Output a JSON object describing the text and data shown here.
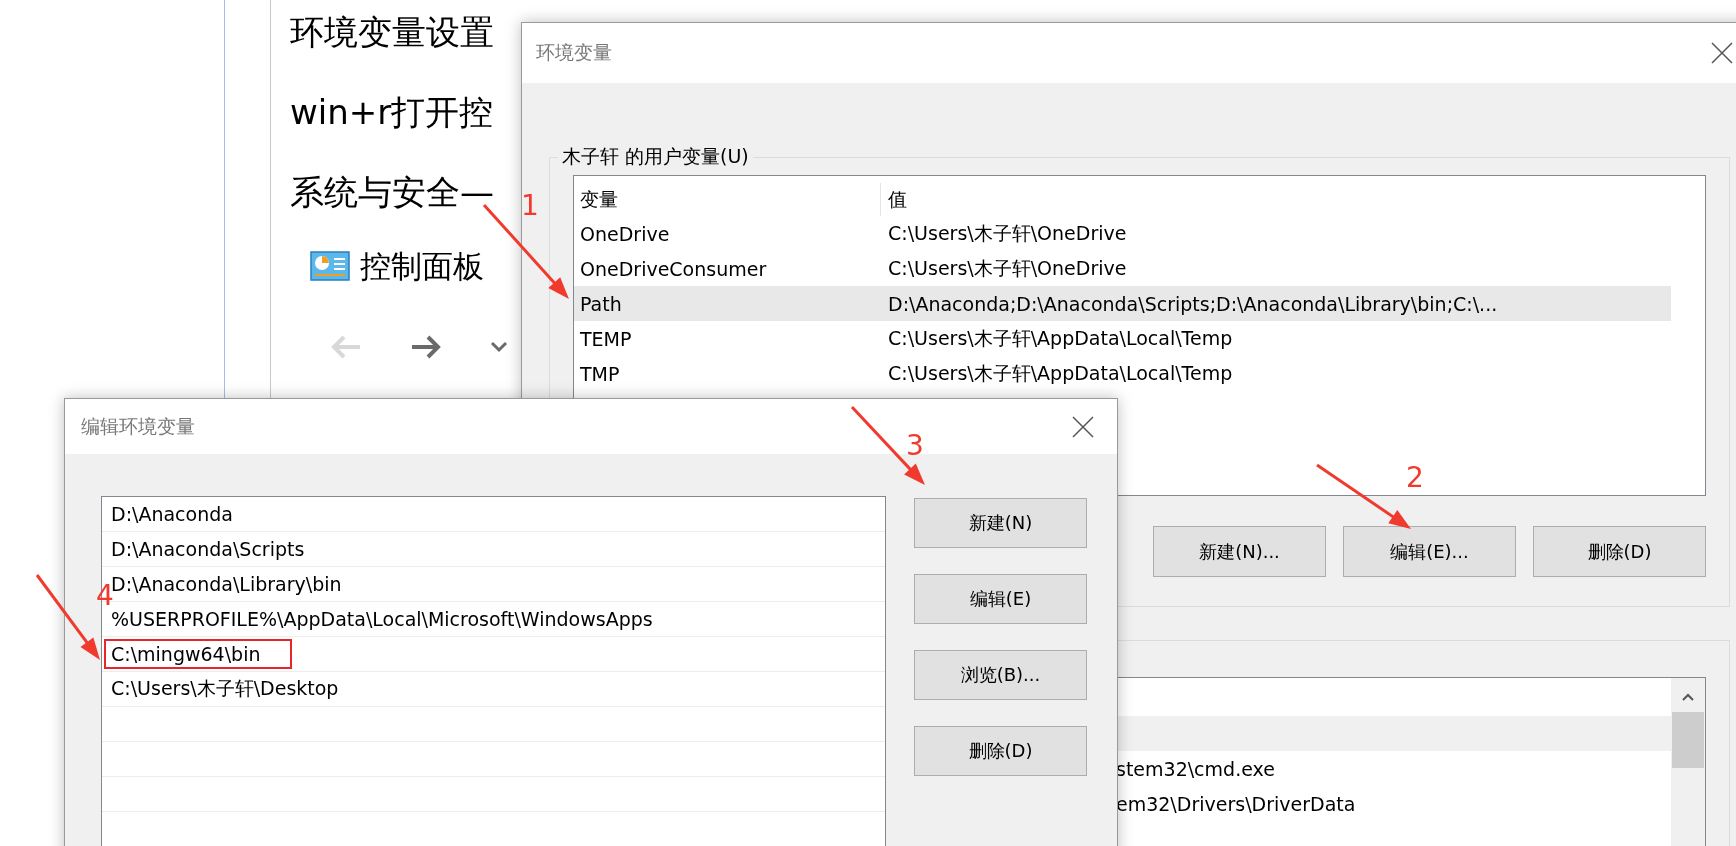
{
  "document": {
    "lines": [
      "环境变量设置",
      "win+r打开控",
      "系统与安全—"
    ],
    "breadcrumb": {
      "label": "控制面板"
    },
    "nav": {
      "back": {
        "disabled": true
      },
      "forward": {
        "disabled": false
      }
    }
  },
  "env_window": {
    "title": "环境变量",
    "user_group": {
      "label": "木子轩 的用户变量(U)",
      "columns": [
        "变量",
        "值"
      ],
      "rows": [
        {
          "name": "OneDrive",
          "value": "C:\\Users\\木子轩\\OneDrive",
          "selected": false
        },
        {
          "name": "OneDriveConsumer",
          "value": "C:\\Users\\木子轩\\OneDrive",
          "selected": false
        },
        {
          "name": "Path",
          "value": "D:\\Anaconda;D:\\Anaconda\\Scripts;D:\\Anaconda\\Library\\bin;C:\\...",
          "selected": true
        },
        {
          "name": "TEMP",
          "value": "C:\\Users\\木子轩\\AppData\\Local\\Temp",
          "selected": false
        },
        {
          "name": "TMP",
          "value": "C:\\Users\\木子轩\\AppData\\Local\\Temp",
          "selected": false
        }
      ],
      "buttons": [
        "新建(N)...",
        "编辑(E)...",
        "删除(D)"
      ]
    },
    "system_group": {
      "rows": [
        {
          "selected": true
        },
        {
          "value": "stem32\\cmd.exe",
          "selected": false
        },
        {
          "value": "em32\\Drivers\\DriverData",
          "selected": false
        }
      ]
    }
  },
  "edit_window": {
    "title": "编辑环境变量",
    "items": [
      {
        "text": "D:\\Anaconda",
        "highlighted": false
      },
      {
        "text": "D:\\Anaconda\\Scripts",
        "highlighted": false
      },
      {
        "text": "D:\\Anaconda\\Library\\bin",
        "highlighted": false
      },
      {
        "text": "%USERPROFILE%\\AppData\\Local\\Microsoft\\WindowsApps",
        "highlighted": false
      },
      {
        "text": "C:\\mingw64\\bin",
        "highlighted": true
      },
      {
        "text": "C:\\Users\\木子轩\\Desktop",
        "highlighted": false
      }
    ],
    "buttons": [
      "新建(N)",
      "编辑(E)",
      "浏览(B)...",
      "删除(D)"
    ]
  },
  "annotations": [
    {
      "label": "1"
    },
    {
      "label": "2"
    },
    {
      "label": "3"
    },
    {
      "label": "4"
    }
  ]
}
